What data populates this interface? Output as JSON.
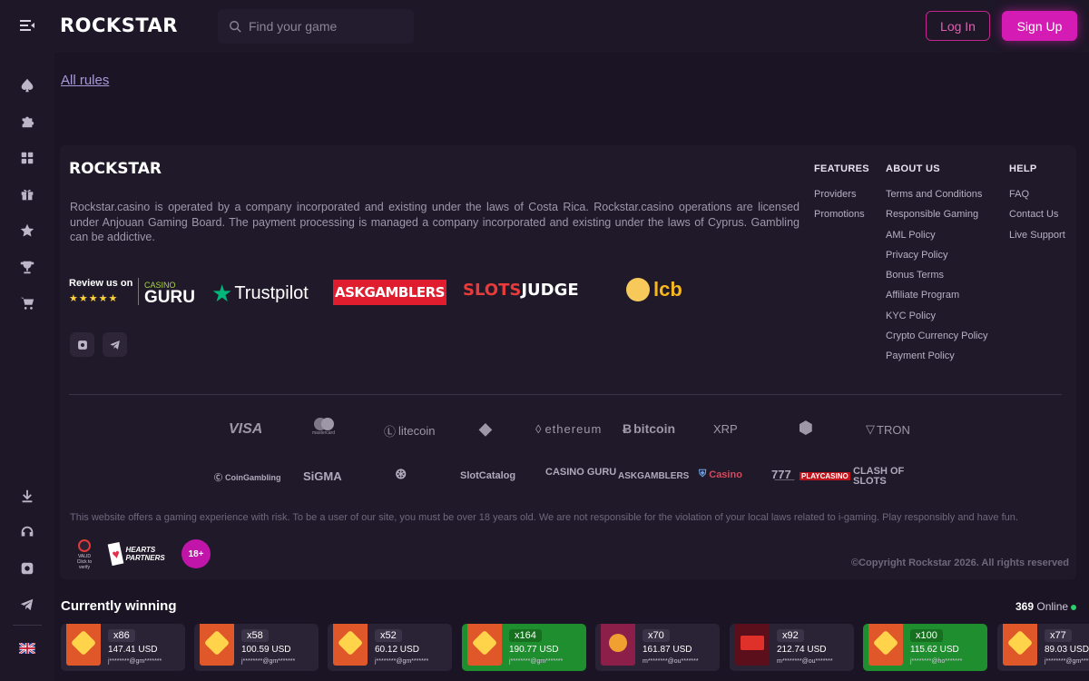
{
  "brand": {
    "logo": "ROCKSTAR",
    "accent": "#d41bb3"
  },
  "header": {
    "search_placeholder": "Find your game",
    "login_label": "Log In",
    "signup_label": "Sign Up"
  },
  "sidebar": {
    "items": [
      "spade-icon",
      "puzzle-icon",
      "grid-icon",
      "gift-icon",
      "star-icon",
      "trophy-icon",
      "cart-icon",
      "download-icon",
      "headset-icon",
      "instagram-icon",
      "telegram-icon",
      "uk-flag-icon"
    ]
  },
  "main": {
    "all_rules": "All rules"
  },
  "footer": {
    "logo": "ROCKSTAR",
    "description": "Rockstar.casino is operated by a company incorporated and existing under the laws of Costa Rica. Rockstar.casino operations are licensed under Anjouan Gaming Board. The payment processing is managed a company incorporated and existing under the laws of Cyprus. Gambling can be addictive.",
    "columns": [
      {
        "title": "FEATURES",
        "links": [
          "Providers",
          "Promotions"
        ]
      },
      {
        "title": "ABOUT US",
        "links": [
          "Terms and Conditions",
          "Responsible Gaming",
          "AML Policy",
          "Privacy Policy",
          "Bonus Terms",
          "Affiliate Program",
          "KYC Policy",
          "Crypto Currency Policy",
          "Payment Policy"
        ]
      },
      {
        "title": "HELP",
        "links": [
          "FAQ",
          "Contact Us",
          "Live Support"
        ]
      }
    ],
    "review": {
      "label": "Review us on",
      "stars": "★★★★★",
      "casino_guru_top": "CASINO",
      "casino_guru": "GURU",
      "trustpilot": "Trustpilot",
      "askgamblers": "ASKGAMBLERS",
      "slots": "SLOTS",
      "judge": "JUDGE",
      "lcb": "lcb"
    },
    "payments": [
      "VISA",
      "mastercard",
      "litecoin",
      "ethereum",
      "bitcoin",
      "XRP",
      "TRON"
    ],
    "partners": [
      "CoinGambling",
      "SiGMA",
      "SlotCatalog",
      "CASINO GURU",
      "ASKGAMBLERS",
      "PLAYCASINO",
      "CLASH OF SLOTS",
      "Casino"
    ],
    "disclaimer": "This website offers a gaming experience with risk. To be a user of our site, you must be over 18 years old. We are not responsible for the violation of your local laws related to i-gaming. Play responsibly and have fun.",
    "valid_label": "VALID",
    "valid_sub": "Click to verify",
    "hearts_partners": "HEARTS PARTNERS",
    "age": "18+",
    "copyright": "©Copyright Rockstar 2026. All rights reserved"
  },
  "winning": {
    "title": "Currently winning",
    "online_count": "369",
    "online_label": "Online",
    "items": [
      {
        "mult": "x86",
        "amount": "147.41 USD",
        "user": "j********@gm*******",
        "green": false,
        "thumb": "diamonds"
      },
      {
        "mult": "x58",
        "amount": "100.59 USD",
        "user": "j********@gm*******",
        "green": false,
        "thumb": "diamonds"
      },
      {
        "mult": "x52",
        "amount": "60.12 USD",
        "user": "j********@gm*******",
        "green": false,
        "thumb": "diamonds"
      },
      {
        "mult": "x164",
        "amount": "190.77 USD",
        "user": "j********@gm*******",
        "green": true,
        "thumb": "diamonds"
      },
      {
        "mult": "x70",
        "amount": "161.87 USD",
        "user": "m********@ou*******",
        "green": false,
        "thumb": "joker"
      },
      {
        "mult": "x92",
        "amount": "212.74 USD",
        "user": "m********@ou*******",
        "green": false,
        "thumb": "burn"
      },
      {
        "mult": "x100",
        "amount": "115.62 USD",
        "user": "j********@ho*******",
        "green": true,
        "thumb": "diamonds"
      },
      {
        "mult": "x77",
        "amount": "89.03 USD",
        "user": "j********@gm*******",
        "green": false,
        "thumb": "diamonds"
      }
    ]
  }
}
